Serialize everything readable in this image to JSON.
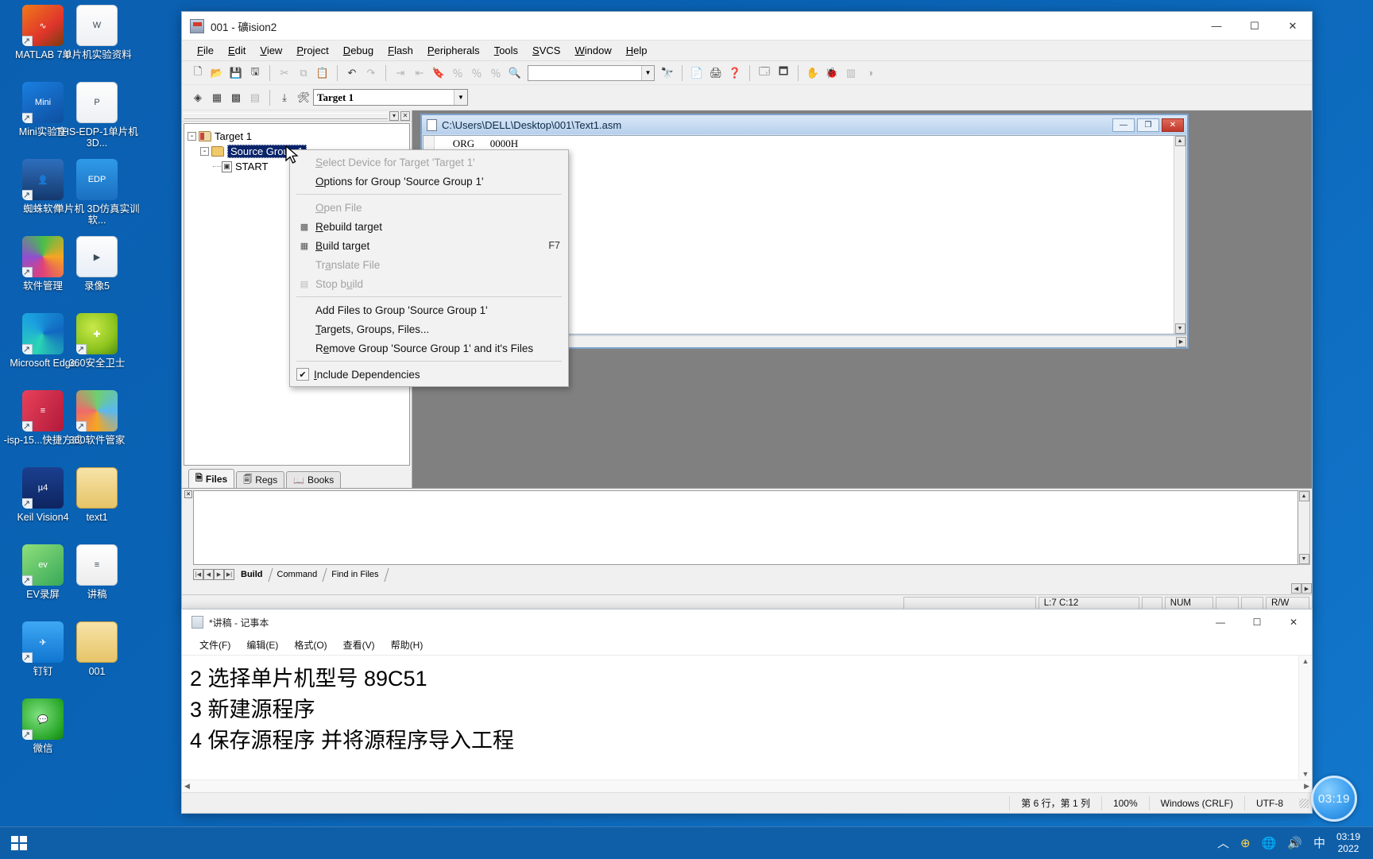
{
  "desktop": {
    "icons": [
      {
        "label": "MATLAB 7.0",
        "kind": "matlab-icon",
        "shortcut": true,
        "col": 0,
        "row": 0
      },
      {
        "label": "单片机实验资料",
        "kind": "word-doc-folder-icon",
        "shortcut": false,
        "col": 1,
        "row": 0
      },
      {
        "label": "Mini实验室",
        "kind": "mini-lab-icon",
        "shortcut": true,
        "col": 0,
        "row": 1
      },
      {
        "label": "THS-EDP-1单片机3D...",
        "kind": "pdf-file-icon",
        "shortcut": false,
        "col": 1,
        "row": 1
      },
      {
        "label": "蜘蛛软件",
        "kind": "spider-software-icon",
        "shortcut": true,
        "col": 0,
        "row": 2
      },
      {
        "label": "单片机 3D仿真实训软...",
        "kind": "edp-app-icon",
        "shortcut": false,
        "col": 1,
        "row": 2
      },
      {
        "label": "软件管理",
        "kind": "software-manager-icon",
        "shortcut": true,
        "col": 0,
        "row": 3
      },
      {
        "label": "录像5",
        "kind": "video-file-icon",
        "shortcut": false,
        "col": 1,
        "row": 3
      },
      {
        "label": "Microsoft Edge",
        "kind": "edge-icon",
        "shortcut": true,
        "col": 0,
        "row": 4
      },
      {
        "label": "360安全卫士",
        "kind": "360-safe-icon",
        "shortcut": true,
        "col": 1,
        "row": 4
      },
      {
        "label": "-isp-15...快捷方式",
        "kind": "isp-tool-icon",
        "shortcut": true,
        "col": 0,
        "row": 5
      },
      {
        "label": "360软件管家",
        "kind": "360-software-manager-icon",
        "shortcut": true,
        "col": 1,
        "row": 5
      },
      {
        "label": "Keil Vision4",
        "kind": "keil-uvision4-icon",
        "shortcut": true,
        "col": 0,
        "row": 6
      },
      {
        "label": "text1",
        "kind": "folder-icon",
        "shortcut": false,
        "col": 1,
        "row": 6
      },
      {
        "label": "EV录屏",
        "kind": "ev-recorder-icon",
        "shortcut": true,
        "col": 0,
        "row": 7
      },
      {
        "label": "讲稿",
        "kind": "text-file-icon",
        "shortcut": false,
        "col": 1,
        "row": 7
      },
      {
        "label": "钉钉",
        "kind": "dingtalk-icon",
        "shortcut": true,
        "col": 0,
        "row": 8
      },
      {
        "label": "001",
        "kind": "folder-icon",
        "shortcut": false,
        "col": 1,
        "row": 8
      },
      {
        "label": "微信",
        "kind": "wechat-icon",
        "shortcut": true,
        "col": 0,
        "row": 9
      }
    ]
  },
  "taskbar": {
    "tray_items": [
      "^",
      "360-shield",
      "network-blocked",
      "speaker",
      "ime-chinese"
    ],
    "ime_label": "中",
    "clock_time": "03:19",
    "clock_date": "2022"
  },
  "clock_gadget": {
    "time": "03:19"
  },
  "keil": {
    "title": "001  - 礦ision2",
    "window_buttons": {
      "minimize": "—",
      "maximize": "☐",
      "close": "✕"
    },
    "menu": [
      "File",
      "Edit",
      "View",
      "Project",
      "Debug",
      "Flash",
      "Peripherals",
      "Tools",
      "SVCS",
      "Window",
      "Help"
    ],
    "toolbar_find_value": "",
    "target_select_value": "Target 1",
    "project": {
      "panel_tabs": [
        {
          "label": "Files",
          "icon": "files-icon",
          "active": true
        },
        {
          "label": "Regs",
          "icon": "regs-icon",
          "active": false
        },
        {
          "label": "Books",
          "icon": "books-icon",
          "active": false
        }
      ],
      "tree": [
        {
          "label": "Target 1",
          "level": 0,
          "expander": "-",
          "icon": "target-folder-icon",
          "selected": false
        },
        {
          "label": "Source Group 1",
          "level": 1,
          "expander": "-",
          "icon": "source-group-folder-icon",
          "selected": true
        },
        {
          "label": "START",
          "level": 2,
          "expander": "",
          "icon": "asm-file-icon",
          "selected": false
        }
      ]
    },
    "editor": {
      "title": "C:\\Users\\DELL\\Desktop\\001\\Text1.asm",
      "buttons": {
        "minimize": "—",
        "restore": "❐",
        "close": "✕"
      },
      "code": "       ORG      0000H"
    },
    "output": {
      "nav_buttons": [
        "|◀",
        "◀",
        "▶",
        "▶|"
      ],
      "tabs": [
        {
          "label": "Build",
          "active": true
        },
        {
          "label": "Command",
          "active": false
        },
        {
          "label": "Find in Files",
          "active": false
        }
      ],
      "text": ""
    },
    "status": {
      "message": "",
      "cursor": "L:7 C:12",
      "num": "NUM",
      "rw": "R/W"
    }
  },
  "context_menu": {
    "items": [
      {
        "label": "Select Device for Target 'Target 1'",
        "disabled": true,
        "icon": "",
        "accel": "",
        "underline": "S"
      },
      {
        "label": "Options for Group 'Source Group 1'",
        "disabled": false,
        "icon": "",
        "accel": "",
        "underline": "O"
      },
      {
        "separator": true
      },
      {
        "label": "Open File",
        "disabled": true,
        "icon": "",
        "accel": "",
        "underline": "O"
      },
      {
        "label": "Rebuild target",
        "disabled": false,
        "icon": "rebuild-icon",
        "accel": "",
        "underline": "R"
      },
      {
        "label": "Build target",
        "disabled": false,
        "icon": "build-icon",
        "accel": "F7",
        "underline": "B"
      },
      {
        "label": "Translate File",
        "disabled": true,
        "icon": "",
        "accel": "",
        "underline": "a"
      },
      {
        "label": "Stop build",
        "disabled": true,
        "icon": "stop-build-icon",
        "accel": "",
        "underline": "u"
      },
      {
        "separator": true
      },
      {
        "label": "Add Files to Group 'Source Group 1'",
        "disabled": false,
        "icon": "",
        "accel": "",
        "underline": ""
      },
      {
        "label": "Targets, Groups, Files...",
        "disabled": false,
        "icon": "",
        "accel": "",
        "underline": "T"
      },
      {
        "label": "Remove Group 'Source Group 1' and it's Files",
        "disabled": false,
        "icon": "",
        "accel": "",
        "underline": "e"
      },
      {
        "separator": true
      },
      {
        "label": "Include Dependencies",
        "disabled": false,
        "checkbox": true,
        "checked": true,
        "accel": "",
        "underline": "I"
      }
    ]
  },
  "notepad": {
    "title": "*讲稿 - 记事本",
    "window_buttons": {
      "minimize": "—",
      "maximize": "☐",
      "close": "✕"
    },
    "menu": [
      "文件(F)",
      "编辑(E)",
      "格式(O)",
      "查看(V)",
      "帮助(H)"
    ],
    "content": "2 选择单片机型号 89C51\n3 新建源程序\n4 保存源程序 并将源程序导入工程",
    "status": {
      "position": "第 6 行，第 1 列",
      "zoom": "100%",
      "line_ending": "Windows (CRLF)",
      "encoding": "UTF-8"
    }
  },
  "colors": {
    "desktop_blue": "#0a63b5",
    "selection_blue": "#0a246a",
    "title_gradient_start": "#d9e7f7",
    "close_red": "#c0392b",
    "taskbar": "#0f5fa8"
  }
}
